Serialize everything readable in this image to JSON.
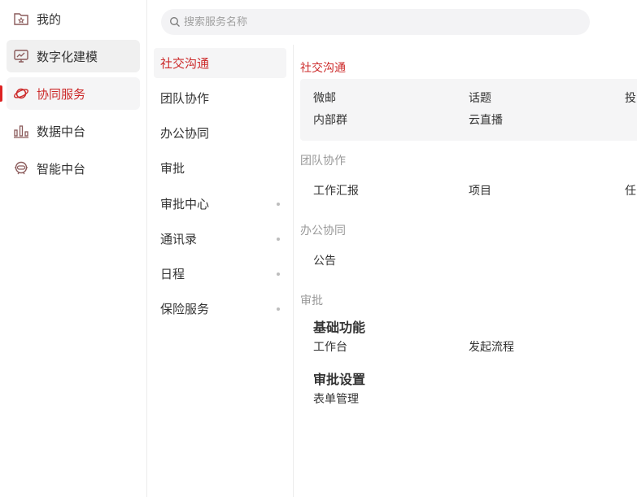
{
  "nav": {
    "items": [
      {
        "label": "我的",
        "icon": "star-folder-icon"
      },
      {
        "label": "数字化建模",
        "icon": "monitor-chart-icon"
      },
      {
        "label": "协同服务",
        "icon": "planet-icon"
      },
      {
        "label": "数据中台",
        "icon": "bar-chart-icon"
      },
      {
        "label": "智能中台",
        "icon": "robot-icon"
      }
    ]
  },
  "search": {
    "placeholder": "搜索服务名称"
  },
  "categories": [
    {
      "label": "社交沟通"
    },
    {
      "label": "团队协作"
    },
    {
      "label": "办公协同"
    },
    {
      "label": "审批"
    },
    {
      "label": "审批中心"
    },
    {
      "label": "通讯录"
    },
    {
      "label": "日程"
    },
    {
      "label": "保险服务"
    }
  ],
  "sections": {
    "social": {
      "title": "社交沟通",
      "items": [
        "微邮",
        "话题",
        "投",
        "内部群",
        "云直播"
      ]
    },
    "team": {
      "title": "团队协作",
      "items": [
        "工作汇报",
        "项目",
        "任"
      ]
    },
    "office": {
      "title": "办公协同",
      "items": [
        "公告"
      ]
    },
    "approval": {
      "title": "审批",
      "groups": [
        {
          "title": "基础功能",
          "items": [
            "工作台",
            "发起流程"
          ]
        },
        {
          "title": "审批设置",
          "items": [
            "表单管理"
          ]
        }
      ]
    }
  },
  "colors": {
    "accent": "#cc2a2a",
    "muted": "#999999",
    "selected_bg": "#f5f5f6"
  }
}
